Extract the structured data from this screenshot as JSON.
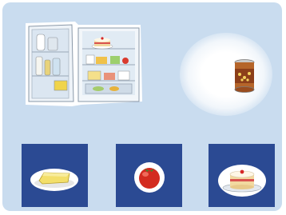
{
  "scene": {
    "background_color": "#c9dcef",
    "tile_color": "#2b4a93",
    "fridge": {
      "icon": "open-fridge-icon"
    },
    "target": {
      "icon": "tin-can-icon"
    }
  },
  "choices": [
    {
      "icon": "butter-icon"
    },
    {
      "icon": "tomato-icon"
    },
    {
      "icon": "cake-icon"
    }
  ]
}
